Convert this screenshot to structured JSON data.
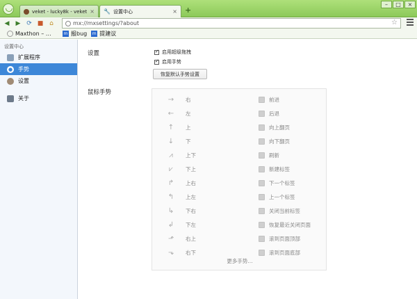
{
  "tabs": [
    {
      "title": "veket - lucky8k - veket",
      "close": "×"
    },
    {
      "title": "设置中心",
      "close": "×"
    }
  ],
  "new_tab": "+",
  "window_buttons": [
    "–",
    "□",
    "×"
  ],
  "url": "mx://mxsettings/?about",
  "bookmarks": [
    "Maxthon – …",
    "报bug",
    "提建议"
  ],
  "sidebar": {
    "title": "设置中心",
    "items": [
      {
        "label": "扩展程序",
        "icon": "extensions-icon"
      },
      {
        "label": "手势",
        "icon": "gesture-icon"
      },
      {
        "label": "设置",
        "icon": "settings-icon"
      },
      {
        "label": "关于",
        "icon": "about-icon"
      }
    ]
  },
  "settings": {
    "label": "设置",
    "options": [
      "启用超级拖拽",
      "启用手势"
    ],
    "reset_button": "恢复默认手势设置"
  },
  "gestures": {
    "label": "鼠标手势",
    "rows": [
      {
        "arrow": "→",
        "name": "右",
        "action": "前进"
      },
      {
        "arrow": "←",
        "name": "左",
        "action": "后退"
      },
      {
        "arrow": "↑",
        "name": "上",
        "action": "向上翻页"
      },
      {
        "arrow": "↓",
        "name": "下",
        "action": "向下翻页"
      },
      {
        "arrow": "⩘",
        "name": "上下",
        "action": "刷新"
      },
      {
        "arrow": "⩗",
        "name": "下上",
        "action": "新建标签"
      },
      {
        "arrow": "↱",
        "name": "上右",
        "action": "下一个标签"
      },
      {
        "arrow": "↰",
        "name": "上左",
        "action": "上一个标签"
      },
      {
        "arrow": "↳",
        "name": "下右",
        "action": "关闭当前标签"
      },
      {
        "arrow": "↲",
        "name": "下左",
        "action": "恢复最近关闭页面"
      },
      {
        "arrow": "⬏",
        "name": "右上",
        "action": "滚到页面顶部"
      },
      {
        "arrow": "⬎",
        "name": "右下",
        "action": "滚到页面底部"
      }
    ],
    "more": "更多手势..."
  }
}
